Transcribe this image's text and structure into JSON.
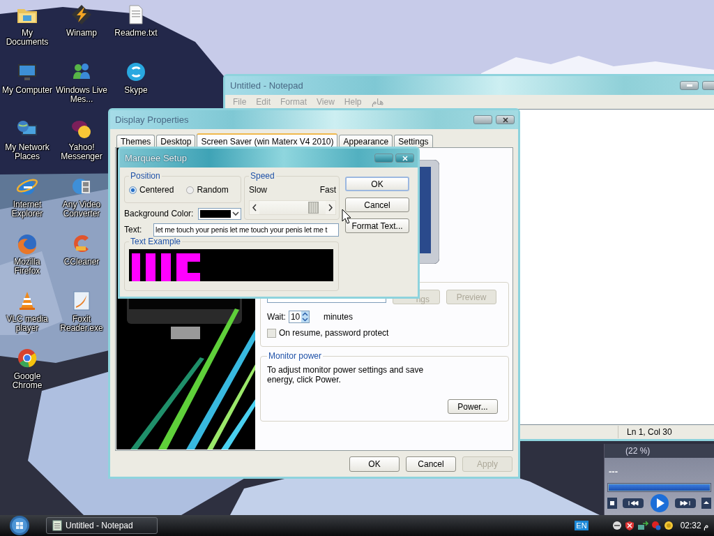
{
  "desktop": {
    "icon_columns": [
      {
        "icons": [
          {
            "label": "My Documents",
            "kind": "folder"
          },
          {
            "label": "My Computer",
            "kind": "computer"
          },
          {
            "label": "My Network Places",
            "kind": "network"
          },
          {
            "label": "Internet Explorer",
            "kind": "ie"
          },
          {
            "label": "Mozilla Firefox",
            "kind": "firefox"
          },
          {
            "label": "VLC media player",
            "kind": "vlc"
          },
          {
            "label": "Google Chrome",
            "kind": "chrome"
          }
        ]
      },
      {
        "icons": [
          {
            "label": "Winamp",
            "kind": "winamp"
          },
          {
            "label": "Windows Live Mes...",
            "kind": "messenger"
          },
          {
            "label": "Yahoo! Messenger",
            "kind": "yahoo"
          },
          {
            "label": "Any Video Converter",
            "kind": "converter"
          },
          {
            "label": "CCleaner",
            "kind": "ccleaner"
          },
          {
            "label": "Foxit Reader.exe",
            "kind": "foxit"
          }
        ]
      },
      {
        "icons": [
          {
            "label": "Readme.txt",
            "kind": "textfile"
          },
          {
            "label": "Skype",
            "kind": "skype"
          }
        ]
      }
    ]
  },
  "notepad": {
    "title": "Untitled - Notepad",
    "menu": [
      "File",
      "Edit",
      "Format",
      "View",
      "Help",
      "هام"
    ],
    "status": "Ln 1, Col 30"
  },
  "display_properties": {
    "title": "Display Properties",
    "tabs": [
      {
        "label": "Themes",
        "selected": false
      },
      {
        "label": "Desktop",
        "selected": false
      },
      {
        "label": "Screen Saver (win  Materx V4 2010)",
        "selected": true
      },
      {
        "label": "Appearance",
        "selected": false
      },
      {
        "label": "Settings",
        "selected": false
      }
    ],
    "screen_saver": {
      "settings_button": "ngs",
      "preview_button": "Preview",
      "wait_label": "Wait:",
      "wait_value": "10",
      "wait_unit": "minutes",
      "password_protect": {
        "label": "On resume, password protect",
        "checked": false
      }
    },
    "monitor_power": {
      "legend": "Monitor power",
      "text": "To adjust monitor power settings and save energy, click Power.",
      "button": "Power..."
    },
    "buttons": [
      {
        "label": "OK",
        "disabled": false
      },
      {
        "label": "Cancel",
        "disabled": false
      },
      {
        "label": "Apply",
        "disabled": true
      }
    ]
  },
  "marquee_setup": {
    "title": "Marquee Setup",
    "position": {
      "legend": "Position",
      "options": [
        {
          "label": "Centered",
          "selected": true
        },
        {
          "label": "Random",
          "selected": false
        }
      ]
    },
    "speed": {
      "legend": "Speed",
      "slow": "Slow",
      "fast": "Fast",
      "level": 0.88
    },
    "background_color": {
      "label": "Background Color:",
      "color": "#000000"
    },
    "text": {
      "label": "Text:",
      "value": "let me touch your penis let me touch your penis let me t"
    },
    "example": {
      "legend": "Text Example"
    },
    "buttons": [
      "OK",
      "Cancel",
      "Format Text..."
    ]
  },
  "media_player": {
    "status": "(22 %)",
    "track": "---",
    "seek": {
      "level": 1
    }
  },
  "taskbar": {
    "tasks": [
      {
        "label": "Untitled - Notepad"
      }
    ],
    "language": "EN",
    "clock": "02:32 م"
  }
}
